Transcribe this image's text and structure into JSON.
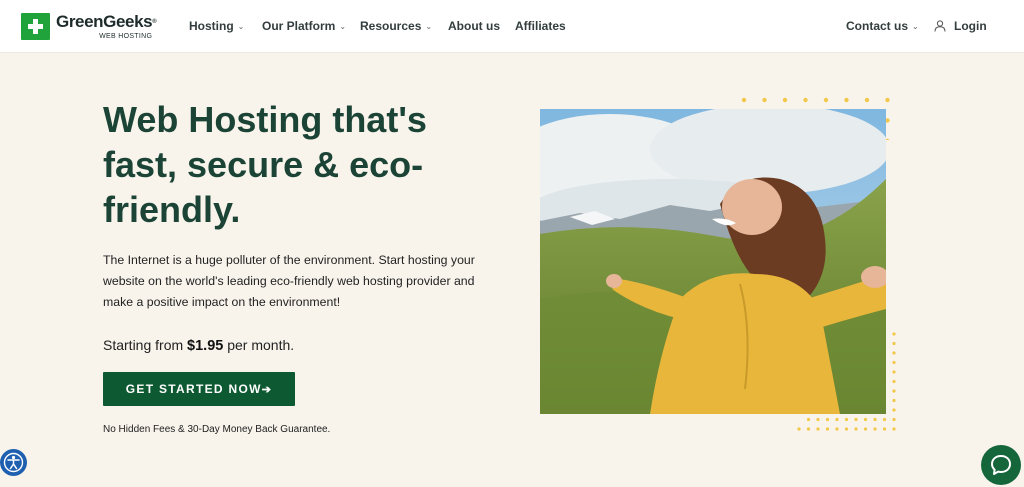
{
  "header": {
    "logo": {
      "name": "GreenGeeks",
      "reg": "®",
      "sub": "WEB HOSTING"
    },
    "nav": [
      {
        "label": "Hosting",
        "dropdown": true
      },
      {
        "label": "Our Platform",
        "dropdown": true
      },
      {
        "label": "Resources",
        "dropdown": true
      },
      {
        "label": "About us",
        "dropdown": false
      },
      {
        "label": "Affiliates",
        "dropdown": false
      }
    ],
    "contact": {
      "label": "Contact us",
      "dropdown": true
    },
    "login": {
      "label": "Login",
      "icon": "user-icon"
    },
    "chevron_glyph": "⌄"
  },
  "hero": {
    "headline": "Web Hosting that's fast, secure & eco-friendly.",
    "intro": "The Internet is a huge polluter of the environment. Start hosting your website on the world's leading eco-friendly web hosting provider and make a positive impact on the environment!",
    "price_prefix": "Starting from ",
    "price": "$1.95",
    "price_suffix": " per month.",
    "cta_label": "GET STARTED NOW",
    "cta_arrow": "➔",
    "guarantee": "No Hidden Fees & 30-Day Money Back Guarantee."
  },
  "widgets": {
    "accessibility_icon": "accessibility-icon",
    "chat_icon": "chat-bubble-icon"
  },
  "colors": {
    "brand_green": "#1fa33a",
    "headline_green": "#1c4436",
    "cta_green": "#0d5a32",
    "dot_yellow": "#f2c84b",
    "background": "#f8f4ec",
    "accessibility_blue": "#1f5fb0"
  }
}
